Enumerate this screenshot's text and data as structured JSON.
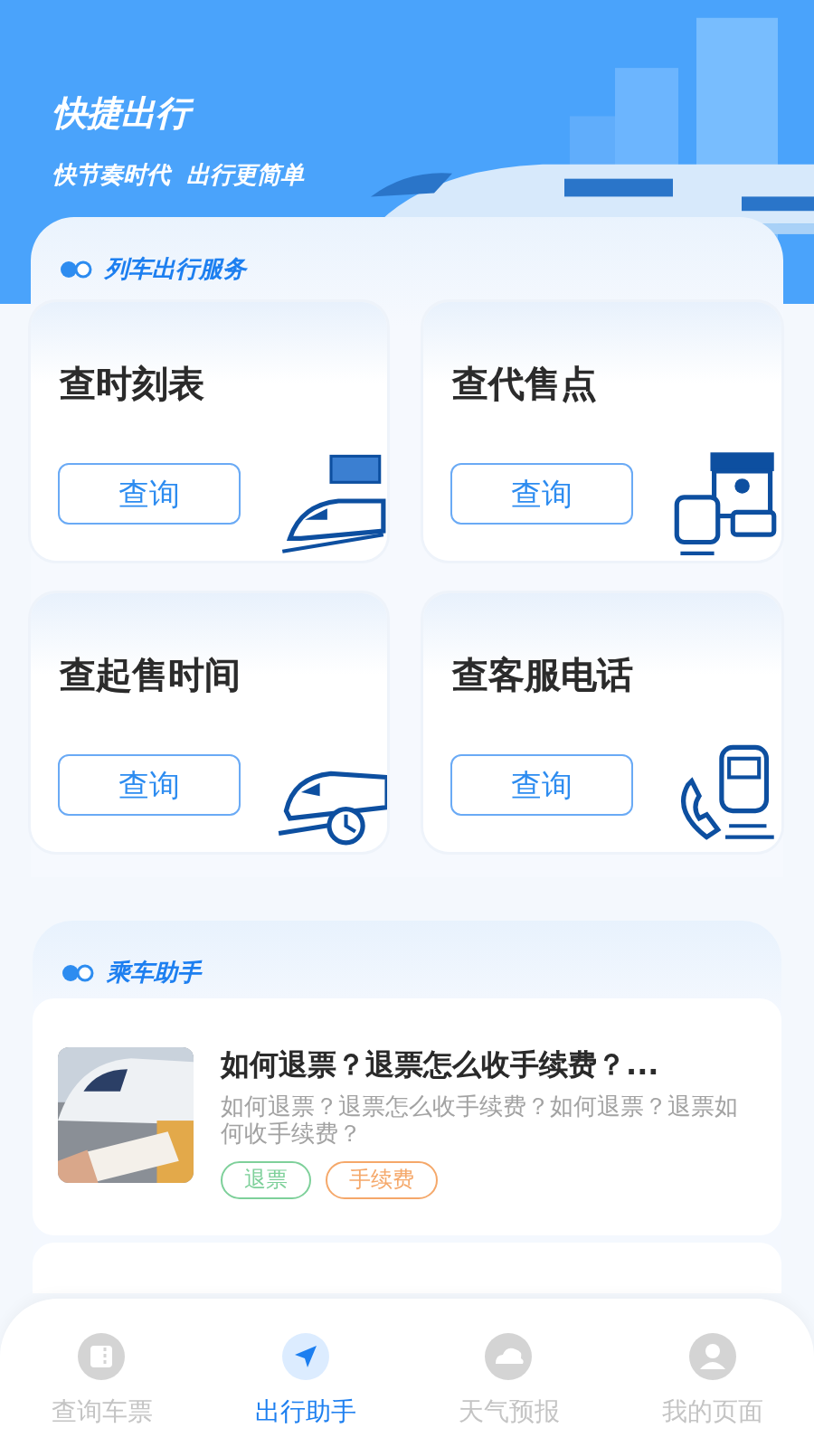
{
  "header": {
    "title": "快捷出行",
    "subtitle": "快节奏时代  出行更简单"
  },
  "services": {
    "heading": "列车出行服务",
    "items": [
      {
        "title": "查时刻表",
        "button": "查询",
        "kind": "timetable"
      },
      {
        "title": "查代售点",
        "button": "查询",
        "kind": "agency"
      },
      {
        "title": "查起售时间",
        "button": "查询",
        "kind": "clock"
      },
      {
        "title": "查客服电话",
        "button": "查询",
        "kind": "phone"
      }
    ]
  },
  "assistant": {
    "heading": "乘车助手",
    "articles": [
      {
        "title": "如何退票？退票怎么收手续费？...",
        "summary": "如何退票？退票怎么收手续费？如何退票？退票如何收手续费？",
        "tags": [
          {
            "label": "退票",
            "color": "#7ed09a"
          },
          {
            "label": "手续费",
            "color": "#f5a86a"
          }
        ]
      }
    ]
  },
  "tab_bar": [
    {
      "label": "查询车票",
      "kind": "ticket",
      "selected": false
    },
    {
      "label": "出行助手",
      "kind": "plane",
      "selected": true
    },
    {
      "label": "天气预报",
      "kind": "cloud",
      "selected": false
    },
    {
      "label": "我的页面",
      "kind": "user",
      "selected": false
    }
  ]
}
